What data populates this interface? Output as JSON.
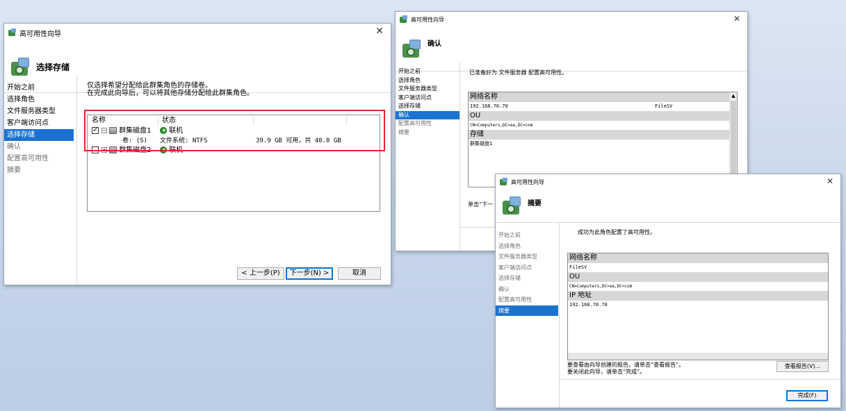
{
  "win1": {
    "title": "高可用性向导",
    "heading": "选择存储",
    "nav": [
      "开始之前",
      "选择角色",
      "文件服务器类型",
      "客户端访问点",
      "选择存储",
      "确认",
      "配置高可用性",
      "摘要"
    ],
    "intro_line1": "仅选择希望分配给此群集角色的存储卷。",
    "intro_line2": "在完成此向导后，可以将其他存储分配给此群集角色。",
    "table": {
      "col_name": "名称",
      "col_status": "状态",
      "disk1_name": "群集磁盘1",
      "disk1_status": "联机",
      "vol_label": "卷: (S)",
      "vol_fs": "文件系统: NTFS",
      "vol_size": "39.9 GB 可用，共 40.0 GB",
      "disk2_name": "群集磁盘2",
      "disk2_status": "联机"
    },
    "btn_prev": "< 上一步(P)",
    "btn_next": "下一步(N) >",
    "btn_cancel": "取消",
    "highlight_color": "#e0262b"
  },
  "win2": {
    "title": "高可用性向导",
    "heading": "确认",
    "nav": [
      "开始之前",
      "选择角色",
      "文件服务器类型",
      "客户端访问点",
      "选择存储",
      "确认",
      "配置高可用性",
      "摘要"
    ],
    "ready_text": "已准备好为 文件服务器 配置高可用性。",
    "sections": {
      "net_name_label": "网络名称",
      "net_ip": "192.168.70.70",
      "net_name": "FileSV",
      "ou_label": "OU",
      "ou_value": "CN=Computers,DC=aa,DC=com",
      "storage_label": "存储",
      "storage_value": "群集磁盘1"
    },
    "click_next": "单击“下一"
  },
  "win3": {
    "title": "高可用性向导",
    "heading": "摘要",
    "nav": [
      "开始之前",
      "选择角色",
      "文件服务器类型",
      "客户端访问点",
      "选择存储",
      "确认",
      "配置高可用性",
      "摘要"
    ],
    "success_text": "成功为此角色配置了高可用性。",
    "sections": {
      "net_name_label": "网络名称",
      "net_name": "FileSV",
      "ou_label": "OU",
      "ou_value": "CN=Computers,DC=aa,DC=com",
      "ip_label": "IP 地址",
      "ip_value": "192.168.70.70"
    },
    "footer_line1": "要查看由向导创建的报告，请单击“查看报告”。",
    "footer_line2": "要关闭此向导，请单击“完成”。",
    "btn_report": "查看报告(V)...",
    "btn_finish": "完成(F)"
  }
}
